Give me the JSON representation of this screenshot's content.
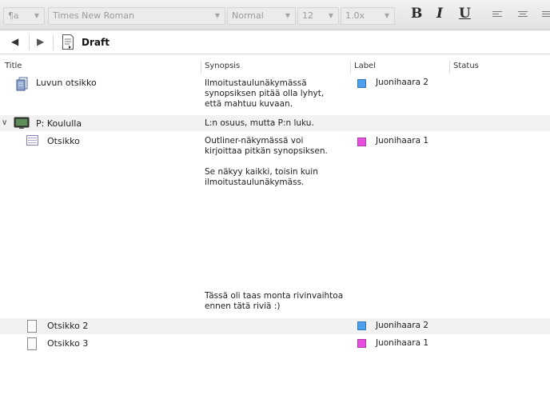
{
  "format_bar": {
    "style_icon": "¶a",
    "font": "Times New Roman",
    "paragraph_style": "Normal",
    "size": "12",
    "line_spacing": "1.0x",
    "bold": "B",
    "italic": "I",
    "underline": "U"
  },
  "nav": {
    "title": "Draft"
  },
  "columns": {
    "title": "Title",
    "synopsis": "Synopsis",
    "label": "Label",
    "status": "Status"
  },
  "rows": [
    {
      "title": "Luvun otsikko",
      "synopsis": "Ilmoitustaulunäkymässä\nsynopsiksen pitää olla lyhyt,\nettä mahtuu kuvaan.",
      "label": "Juonihaara 2",
      "label_color": "#4a9ff0",
      "icon": "folder-stack-icon"
    },
    {
      "title": "P: Koululla",
      "synopsis": "L:n osuus, mutta P:n luku.",
      "label": "",
      "icon": "folder-monitor-icon",
      "expanded": true
    },
    {
      "title": "Otsikko",
      "synopsis": "Outliner-näkymässä voi\nkirjoittaa pitkän synopsiksen.\n\nSe näkyy kaikki, toisin kuin\nilmoitustaulunäkymäss.",
      "synopsis_tail": "Tässä oli taas monta rivinvaihtoa\nennen tätä riviä :)",
      "label": "Juonihaara 1",
      "label_color": "#e84ee0",
      "icon": "text-card-icon"
    },
    {
      "title": "Otsikko 2",
      "synopsis": "",
      "label": "Juonihaara 2",
      "label_color": "#4a9ff0",
      "icon": "blank-page-icon"
    },
    {
      "title": "Otsikko 3",
      "synopsis": "",
      "label": "Juonihaara 1",
      "label_color": "#e84ee0",
      "icon": "blank-page-icon"
    }
  ]
}
